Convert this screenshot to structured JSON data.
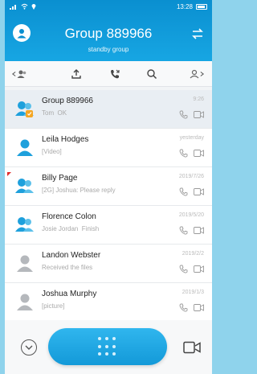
{
  "status": {
    "time": "13:28"
  },
  "header": {
    "title": "Group 889966",
    "subtitle": "standby group"
  },
  "conversations": [
    {
      "name": "Group 889966",
      "preview": "Tom  OK",
      "time": "9:26"
    },
    {
      "name": "Leila Hodges",
      "preview": "[Video]",
      "time": "yesterday"
    },
    {
      "name": "Billy Page",
      "preview": "[2G] Joshua: Please reply",
      "time": "2019/7/26"
    },
    {
      "name": "Florence Colon",
      "preview": "Josie Jordan  Finish",
      "time": "2019/5/20"
    },
    {
      "name": "Landon Webster",
      "preview": "Received the files",
      "time": "2019/2/2"
    },
    {
      "name": "Joshua Murphy",
      "preview": "[picture]",
      "time": "2019/1/3"
    }
  ],
  "colors": {
    "accent": "#1399d8",
    "header": "#0a8fd0",
    "unread_flag": "#e02a2a",
    "badge": "#f5a623"
  }
}
